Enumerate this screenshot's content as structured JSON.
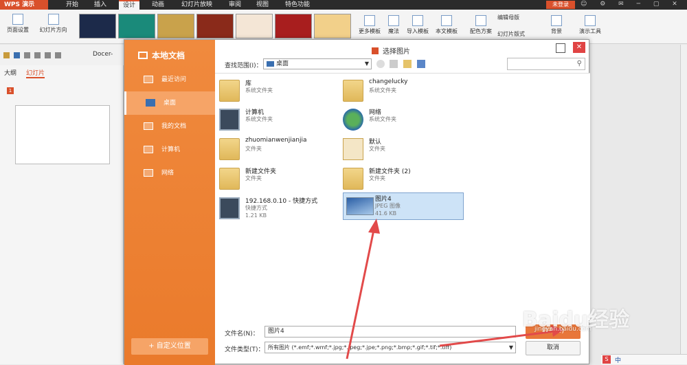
{
  "app": {
    "menu_label": "WPS 演示",
    "tabs": [
      "开始",
      "插入",
      "设计",
      "动画",
      "幻灯片放映",
      "审阅",
      "视图",
      "特色功能"
    ],
    "active_tab": "设计",
    "login": "未登录"
  },
  "ribbon": {
    "page_setup": "页面设置",
    "slide_orientation": "幻灯片方向",
    "more_templates": "更多模板",
    "magic": "魔法",
    "import_template": "导入模板",
    "this_doc_template": "本文模板",
    "color_scheme": "配色方案",
    "edit_master": "编辑母版",
    "slide_layout": "幻灯片版式",
    "background": "背景",
    "presentation_tools": "演示工具"
  },
  "qab": {
    "docer_tab": "Docer-"
  },
  "left_pane": {
    "tabs": [
      "大纲",
      "幻灯片"
    ],
    "active_tab": "幻灯片",
    "slide_number": "1"
  },
  "dialog": {
    "sidebar_title": "本地文档",
    "sidebar_items": [
      {
        "label": "最近访问"
      },
      {
        "label": "桌面"
      },
      {
        "label": "我的文档"
      },
      {
        "label": "计算机"
      },
      {
        "label": "网络"
      }
    ],
    "active_item": "桌面",
    "custom_location": "+ 自定义位置",
    "title": "选择图片",
    "look_in_label": "查找范围(I)：",
    "look_in_value": "桌面",
    "files": [
      {
        "name": "库",
        "type": "系统文件夹",
        "size": "",
        "icon": "folder"
      },
      {
        "name": "changelucky",
        "type": "系统文件夹",
        "size": "",
        "icon": "user-folder"
      },
      {
        "name": "计算机",
        "type": "系统文件夹",
        "size": "",
        "icon": "computer"
      },
      {
        "name": "网络",
        "type": "系统文件夹",
        "size": "",
        "icon": "network"
      },
      {
        "name": "zhuomianwenjianjia",
        "type": "文件夹",
        "size": "",
        "icon": "folder"
      },
      {
        "name": "默认",
        "type": "文件夹",
        "size": "",
        "icon": "doc-folder"
      },
      {
        "name": "新建文件夹",
        "type": "文件夹",
        "size": "",
        "icon": "folder"
      },
      {
        "name": "新建文件夹 (2)",
        "type": "文件夹",
        "size": "",
        "icon": "folder"
      },
      {
        "name": "192.168.0.10 - 快捷方式",
        "type": "快捷方式",
        "size": "1.21 KB",
        "icon": "shortcut"
      },
      {
        "name": "图片4",
        "type": "JPEG 图像",
        "size": "41.6 KB",
        "icon": "image"
      }
    ],
    "selected_file": "图片4",
    "filename_label": "文件名(N)：",
    "filename_value": "图片4",
    "filetype_label": "文件类型(T)：",
    "filetype_value": "所有图片 (*.emf;*.wmf;*.jpg;*.jpeg;*.jpe;*.png;*.bmp;*.gif;*.tif;*.tiff)",
    "open_button": "打开(O)",
    "cancel_button": "取消"
  },
  "watermark": {
    "main": "Baidu经验",
    "sub": "jingyan.baidu.com"
  },
  "tray": {
    "ime": "中"
  },
  "colors": {
    "accent": "#d9502b",
    "sidebar": "#ee8035",
    "arrow": "#e24a4a"
  }
}
